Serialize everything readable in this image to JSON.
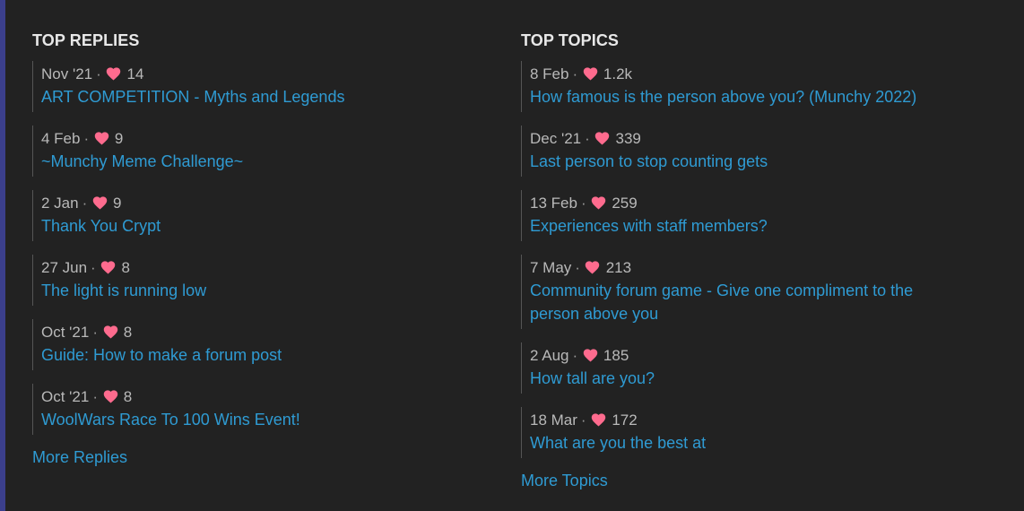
{
  "accent_color": "#3b3f8c",
  "link_color": "#2f9bd3",
  "heart_color": "#fe6b8e",
  "top_replies": {
    "heading": "TOP REPLIES",
    "more_label": "More Replies",
    "items": [
      {
        "date": "Nov '21",
        "likes": "14",
        "title": "ART COMPETITION - Myths and Legends"
      },
      {
        "date": "4 Feb",
        "likes": "9",
        "title": "~Munchy Meme Challenge~"
      },
      {
        "date": "2 Jan",
        "likes": "9",
        "title": "Thank You Crypt"
      },
      {
        "date": "27 Jun",
        "likes": "8",
        "title": "The light is running low"
      },
      {
        "date": "Oct '21",
        "likes": "8",
        "title": "Guide: How to make a forum post"
      },
      {
        "date": "Oct '21",
        "likes": "8",
        "title": "WoolWars Race To 100 Wins Event!"
      }
    ]
  },
  "top_topics": {
    "heading": "TOP TOPICS",
    "more_label": "More Topics",
    "items": [
      {
        "date": "8 Feb",
        "likes": "1.2k",
        "title": "How famous is the person above you? (Munchy 2022)"
      },
      {
        "date": "Dec '21",
        "likes": "339",
        "title": "Last person to stop counting gets"
      },
      {
        "date": "13 Feb",
        "likes": "259",
        "title": "Experiences with staff members?"
      },
      {
        "date": "7 May",
        "likes": "213",
        "title": "Community forum game - Give one compliment to the person above you"
      },
      {
        "date": "2 Aug",
        "likes": "185",
        "title": "How tall are you?"
      },
      {
        "date": "18 Mar",
        "likes": "172",
        "title": "What are you the best at"
      }
    ]
  }
}
